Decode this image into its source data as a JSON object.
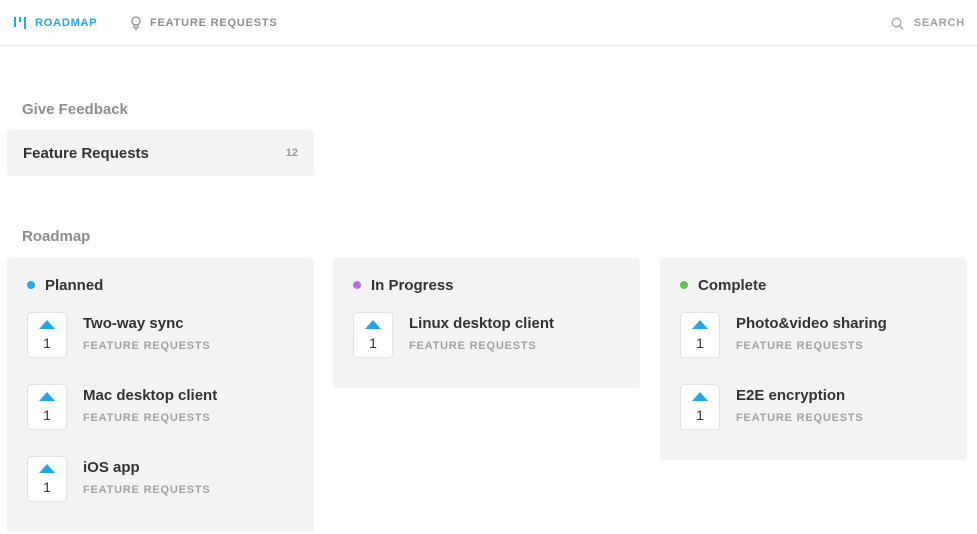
{
  "nav": {
    "roadmap_label": "ROADMAP",
    "feature_requests_label": "FEATURE REQUESTS",
    "search_label": "SEARCH",
    "active_color": "#24a8e0"
  },
  "give_feedback": {
    "heading": "Give Feedback",
    "boards": [
      {
        "name": "Feature Requests",
        "count": "12"
      }
    ]
  },
  "roadmap": {
    "heading": "Roadmap",
    "columns": [
      {
        "title": "Planned",
        "dot_color": "#2ea4e8",
        "posts": [
          {
            "title": "Two-way sync",
            "board": "FEATURE REQUESTS",
            "votes": "1"
          },
          {
            "title": "Mac desktop client",
            "board": "FEATURE REQUESTS",
            "votes": "1"
          },
          {
            "title": "iOS app",
            "board": "FEATURE REQUESTS",
            "votes": "1"
          }
        ]
      },
      {
        "title": "In Progress",
        "dot_color": "#b66ee8",
        "posts": [
          {
            "title": "Linux desktop client",
            "board": "FEATURE REQUESTS",
            "votes": "1"
          }
        ]
      },
      {
        "title": "Complete",
        "dot_color": "#5ec94a",
        "posts": [
          {
            "title": "Photo&video sharing",
            "board": "FEATURE REQUESTS",
            "votes": "1"
          },
          {
            "title": "E2E encryption",
            "board": "FEATURE REQUESTS",
            "votes": "1"
          }
        ]
      }
    ]
  },
  "icons": {
    "roadmap": "roadmap-icon",
    "feature_requests": "lightbulb-icon",
    "search": "search-icon",
    "upvote": "upvote-arrow-icon"
  }
}
